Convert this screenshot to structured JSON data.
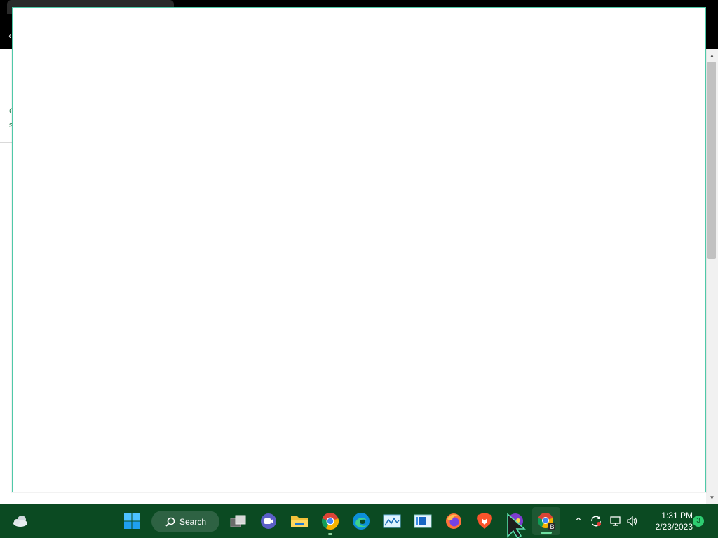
{
  "browser": {
    "back_glyph": "‹",
    "peek_lines": [
      "C",
      "s"
    ]
  },
  "dialog": {
    "content": ""
  },
  "taskbar": {
    "search_label": "Search",
    "apps": [
      {
        "name": "start-button"
      },
      {
        "name": "task-view"
      },
      {
        "name": "teams-meet"
      },
      {
        "name": "file-explorer"
      },
      {
        "name": "chrome"
      },
      {
        "name": "edge"
      },
      {
        "name": "photos-app"
      },
      {
        "name": "media-player"
      },
      {
        "name": "firefox"
      },
      {
        "name": "brave"
      },
      {
        "name": "tor-app"
      },
      {
        "name": "chrome-profile-b"
      }
    ],
    "profile_badge": "B",
    "clock": {
      "time": "1:31 PM",
      "date": "2/23/2023"
    },
    "notification_count": "3",
    "tray_glyphs": {
      "overflow": "⌃",
      "volume": "🔊"
    }
  },
  "colors": {
    "taskbar_bg": "#0b4a22",
    "dialog_border": "#4fc9a8",
    "badge": "#2ecc71"
  }
}
